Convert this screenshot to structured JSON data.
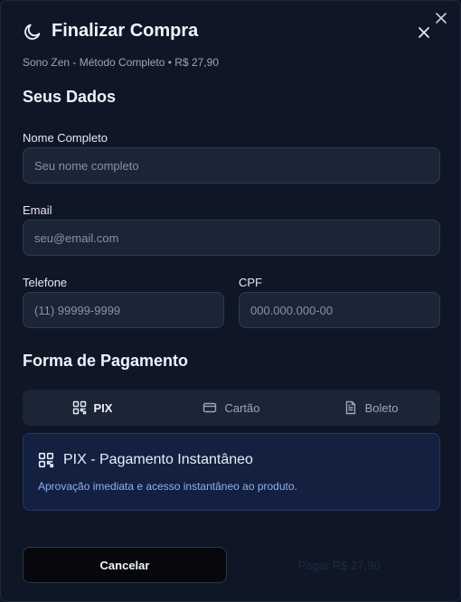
{
  "header": {
    "title": "Finalizar Compra",
    "subtitle": "Sono Zen - Método Completo • R$ 27,90"
  },
  "personal": {
    "section_title": "Seus Dados",
    "name": {
      "label": "Nome Completo",
      "placeholder": "Seu nome completo",
      "value": ""
    },
    "email": {
      "label": "Email",
      "placeholder": "seu@email.com",
      "value": ""
    },
    "phone": {
      "label": "Telefone",
      "placeholder": "(11) 99999-9999",
      "value": ""
    },
    "cpf": {
      "label": "CPF",
      "placeholder": "000.000.000-00",
      "value": ""
    }
  },
  "payment": {
    "section_title": "Forma de Pagamento",
    "tabs": [
      {
        "label": "PIX",
        "icon": "qr-code-icon",
        "active": true
      },
      {
        "label": "Cartão",
        "icon": "credit-card-icon",
        "active": false
      },
      {
        "label": "Boleto",
        "icon": "document-icon",
        "active": false
      }
    ],
    "pix": {
      "title": "PIX - Pagamento Instantâneo",
      "description": "Aprovação imediata e acesso instantâneo ao produto."
    }
  },
  "actions": {
    "cancel_label": "Cancelar",
    "pay_label": "Pagar R$ 27,90"
  },
  "colors": {
    "background": "#0f1727",
    "input_bg": "#1b2535",
    "pix_box_bg": "#13203f",
    "pix_text": "#8fb3f0"
  }
}
